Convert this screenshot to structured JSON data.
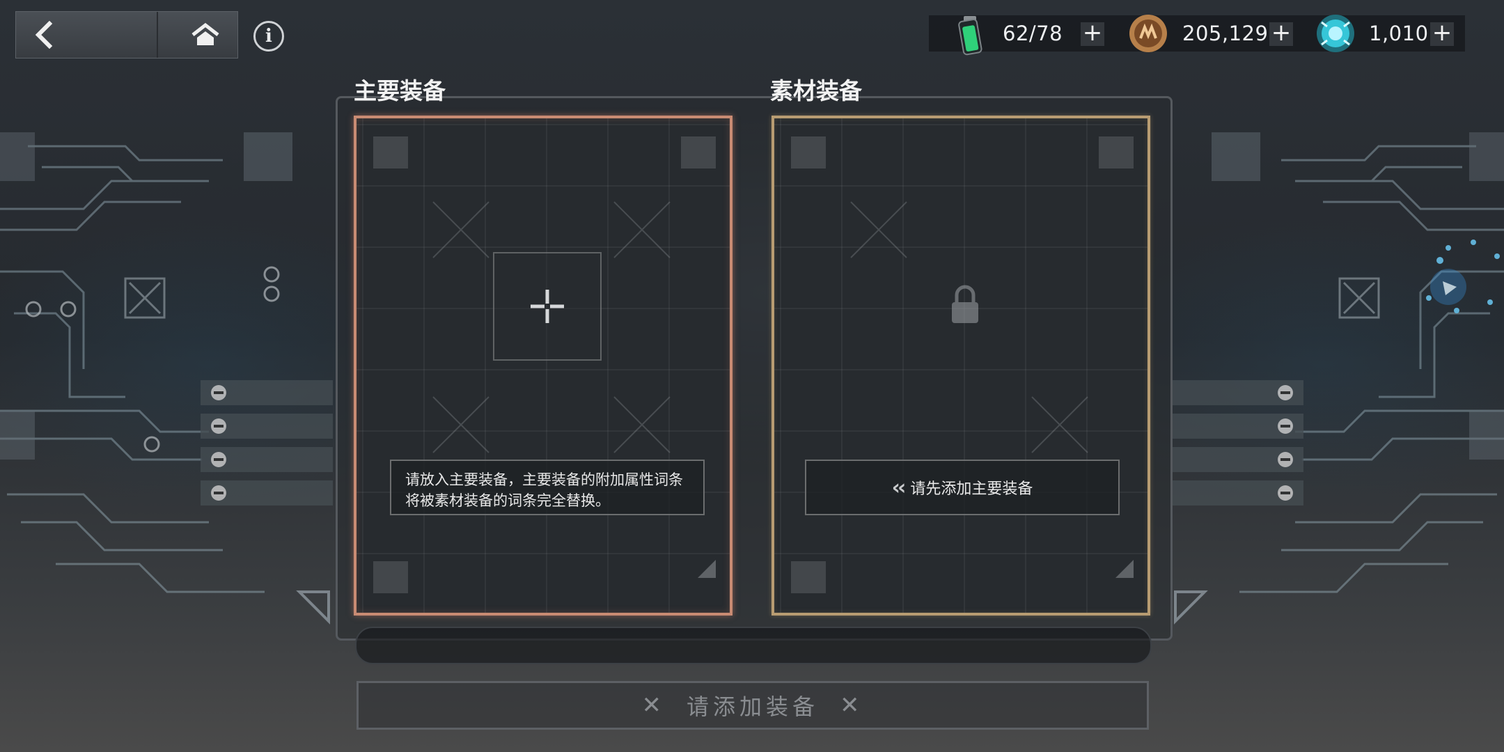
{
  "topbar": {
    "back_icon": "chevron-left-icon",
    "home_icon": "home-icon",
    "info_label": "i"
  },
  "resources": [
    {
      "icon": "stamina-battery-icon",
      "value": "62/78",
      "plus": "+",
      "color": "#2fd07a"
    },
    {
      "icon": "gold-coin-icon",
      "value": "205,129",
      "plus": "+",
      "color": "#b7804a"
    },
    {
      "icon": "crystal-gem-icon",
      "value": "1,010",
      "plus": "+",
      "color": "#36c6d8"
    }
  ],
  "main_equipment": {
    "title": "主要装备",
    "hint_line1": "请放入主要装备，主要装备的附加属性词条",
    "hint_line2": "将被素材装备的词条完全替换。",
    "frame_color": "#c98b73"
  },
  "material_equipment": {
    "title": "素材装备",
    "notice": "请先添加主要装备",
    "frame_color": "#b89c72"
  },
  "submit": {
    "label": "请添加装备",
    "x": "✕"
  }
}
